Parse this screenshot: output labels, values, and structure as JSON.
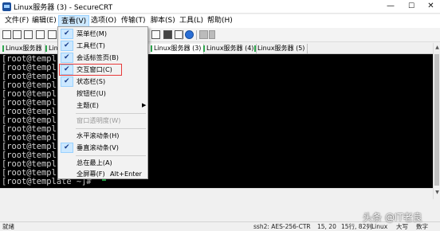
{
  "window": {
    "title": "Linux服务器 (3) - SecureCRT",
    "minimize_glyph": "—",
    "maximize_glyph": "☐",
    "close_glyph": "✕"
  },
  "menubar": [
    {
      "label": "文件(F)"
    },
    {
      "label": "编辑(E)"
    },
    {
      "label": "查看(V)"
    },
    {
      "label": "选项(O)"
    },
    {
      "label": "传输(T)"
    },
    {
      "label": "脚本(S)"
    },
    {
      "label": "工具(L)"
    },
    {
      "label": "帮助(H)"
    }
  ],
  "tabs": [
    {
      "label": "Linux服务器"
    },
    {
      "label": "Lin"
    },
    {
      "label": "Linux服务器 (3)"
    },
    {
      "label": "Linux服务器 (4)"
    },
    {
      "label": "Linux服务器 (5)"
    }
  ],
  "terminal": {
    "lines": [
      "[root@templ",
      "[root@templ",
      "[root@templ",
      "[root@templ",
      "[root@templ",
      "[root@templ",
      "[root@templ",
      "[root@templ",
      "[root@templ",
      "[root@templ",
      "[root@templ",
      "[root@templ",
      "[root@templ",
      "[root@templ",
      "[root@template ~]# "
    ],
    "cursor_color": "#2fd05a"
  },
  "view_menu": {
    "items": [
      {
        "label": "菜单栏(M)",
        "checked": true
      },
      {
        "label": "工具栏(T)",
        "checked": true
      },
      {
        "label": "会话标签页(B)",
        "checked": true
      },
      {
        "label": "交互窗口(C)",
        "checked": true
      },
      {
        "label": "状态栏(S)",
        "checked": true
      },
      {
        "label": "按钮栏(U)",
        "checked": false
      },
      {
        "label": "主题(E)",
        "checked": false,
        "submenu": true
      },
      {
        "label": "窗口透明度(W)",
        "checked": false,
        "disabled": true
      },
      {
        "label": "水平滚动条(H)",
        "checked": false
      },
      {
        "label": "垂直滚动条(V)",
        "checked": true
      },
      {
        "label": "总在最上(A)",
        "checked": false
      },
      {
        "label": "全屏幕(F)",
        "checked": false,
        "shortcut": "Alt+Enter"
      }
    ],
    "check_glyph": "✔",
    "submenu_glyph": "▶",
    "highlight_color": "#e8393a"
  },
  "statusbar": {
    "left_text": "就绪",
    "cipher": "ssh2: AES-256-CTR",
    "cursor_pos": "15, 20",
    "rows_cols": "15行, 82列",
    "term_type": "Linux",
    "caps": "大写",
    "num": "数字"
  },
  "watermark": "头条 @IT老良"
}
